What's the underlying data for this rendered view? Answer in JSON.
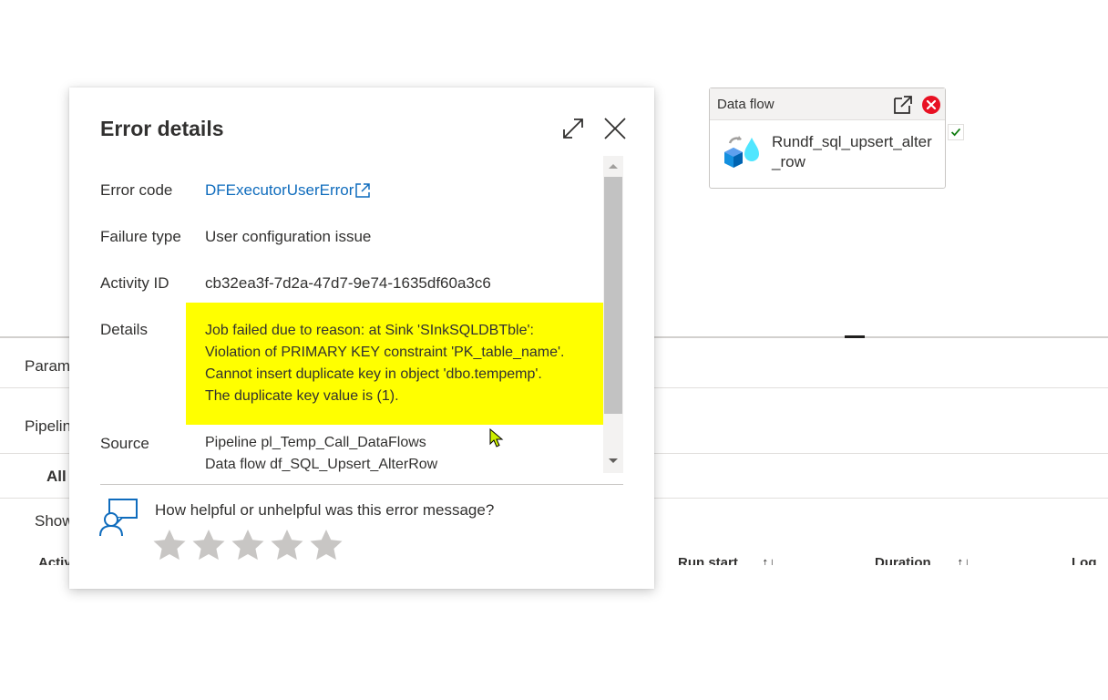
{
  "background": {
    "tabs_label": "Param",
    "pipeline_label": "Pipelin",
    "filter_label": "All",
    "show_label": "Show",
    "columns": [
      {
        "label": "Activi"
      },
      {
        "label": "Run start"
      },
      {
        "label": "Duration"
      },
      {
        "label": "Log"
      }
    ],
    "sort_glyph": "↑↓"
  },
  "data_flow_node": {
    "header": "Data flow",
    "name": "Rundf_sql_upsert_alter_row",
    "status_color": "#107c10",
    "error_color": "#e81123"
  },
  "dialog": {
    "title": "Error details",
    "rows": {
      "error_code_label": "Error code",
      "error_code_value": "DFExecutorUserError",
      "failure_type_label": "Failure type",
      "failure_type_value": "User configuration issue",
      "activity_id_label": "Activity ID",
      "activity_id_value": "cb32ea3f-7d2a-47d7-9e74-1635df60a3c6",
      "details_label": "Details",
      "details_lines": [
        "Job failed due to reason: at Sink 'SInkSQLDBTble':",
        "Violation of PRIMARY KEY constraint 'PK_table_name'.",
        "Cannot insert duplicate key in object 'dbo.tempemp'.",
        "The duplicate key value is (1)."
      ],
      "source_label": "Source",
      "source_lines": [
        "Pipeline pl_Temp_Call_DataFlows",
        "Data flow df_SQL_Upsert_AlterRow"
      ]
    },
    "feedback": {
      "question": "How helpful or unhelpful was this error message?",
      "rating": 0,
      "max_rating": 5
    },
    "highlight_color": "#ffff00",
    "link_color": "#0f6cbd"
  }
}
